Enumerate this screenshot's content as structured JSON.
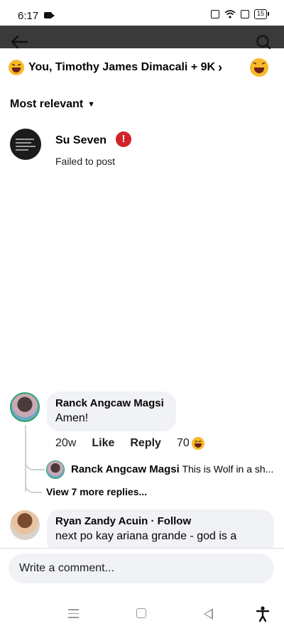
{
  "status_bar": {
    "time": "6:17",
    "battery": "15"
  },
  "header": {
    "reactors_text": "You, Timothy James Dimacali + 9K",
    "sort_label": "Most relevant"
  },
  "failed_comment": {
    "author": "Su Seven",
    "status": "Failed to post"
  },
  "comments": [
    {
      "author": "Ranck Angcaw Magsi",
      "text": "Amen!",
      "time": "20w",
      "like_label": "Like",
      "reply_label": "Reply",
      "reaction_count": "70",
      "reply_preview": {
        "author": "Ranck Angcaw Magsi",
        "text": "This is Wolf in a sh..."
      },
      "view_more": "View 7 more replies..."
    },
    {
      "author": "Ryan Zandy Acuin",
      "follow": "· Follow",
      "text": "next po kay ariana grande - god is a"
    }
  ],
  "composer": {
    "placeholder": "Write a comment..."
  },
  "colors": {
    "error": "#d2232a",
    "haha": "#f7b928",
    "bubble": "#f0f2f5",
    "online_ring": "#2aa56b"
  },
  "icons": [
    "back-arrow-icon",
    "search-icon",
    "haha-emoji-icon",
    "chevron-right-icon",
    "chevron-down-icon",
    "error-icon",
    "menu-icon",
    "home-icon",
    "back-icon",
    "accessibility-icon"
  ]
}
